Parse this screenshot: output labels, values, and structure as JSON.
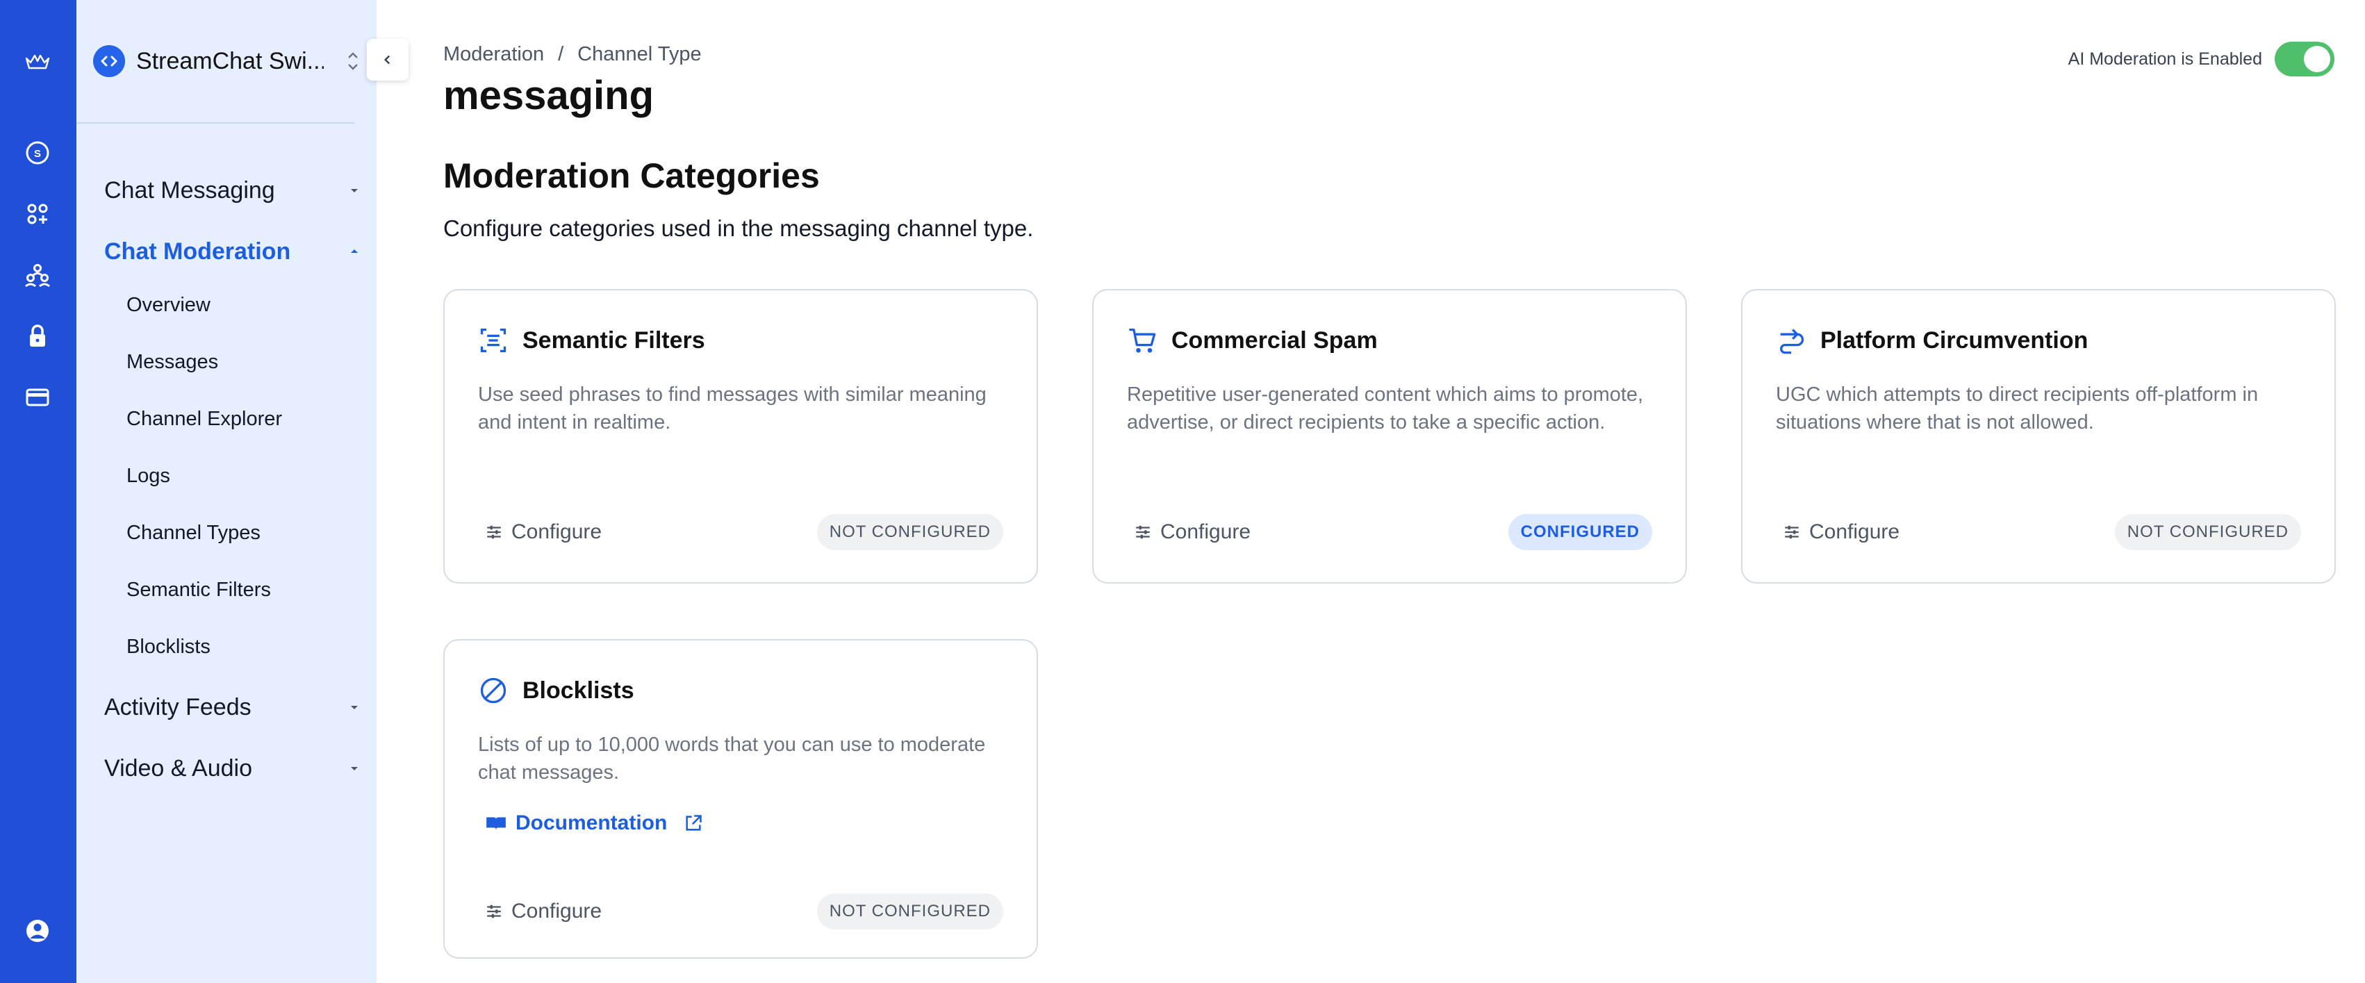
{
  "rail": {
    "icons": [
      "boat-logo-icon",
      "dollar-icon",
      "apps-icon",
      "team-icon",
      "lock-icon",
      "billing-card-icon",
      "account-icon"
    ]
  },
  "project": {
    "name": "StreamChat Swi..."
  },
  "sidebar": {
    "sections": [
      {
        "label": "Chat Messaging",
        "expanded": false
      },
      {
        "label": "Chat Moderation",
        "expanded": true
      },
      {
        "label": "Activity Feeds",
        "expanded": false
      },
      {
        "label": "Video & Audio",
        "expanded": false
      }
    ],
    "moderation_items": [
      "Overview",
      "Messages",
      "Channel Explorer",
      "Logs",
      "Channel Types",
      "Semantic Filters",
      "Blocklists"
    ]
  },
  "breadcrumb": {
    "parent": "Moderation",
    "separator": "/",
    "current": "Channel Type"
  },
  "page": {
    "title": "messaging",
    "section_title": "Moderation Categories",
    "section_desc": "Configure categories used in the messaging channel type."
  },
  "ai_toggle": {
    "label": "AI Moderation is Enabled",
    "enabled": true
  },
  "cards": [
    {
      "title": "Semantic Filters",
      "icon": "filter-lines-icon",
      "text": "Use seed phrases to find messages with similar meaning and intent in realtime.",
      "configure_label": "Configure",
      "status": "NOT CONFIGURED"
    },
    {
      "title": "Commercial Spam",
      "icon": "shopping-cart-icon",
      "text": "Repetitive user-generated content which aims to promote, advertise, or direct recipients to take a specific action.",
      "configure_label": "Configure",
      "status": "CONFIGURED"
    },
    {
      "title": "Platform Circumvention",
      "icon": "redirect-route-icon",
      "text": "UGC which attempts to direct recipients off-platform in situations where that is not allowed.",
      "configure_label": "Configure",
      "status": "NOT CONFIGURED"
    },
    {
      "title": "Blocklists",
      "icon": "block-icon",
      "text": "Lists of up to 10,000 words that you can use to moderate chat messages.",
      "link_label": "Documentation",
      "configure_label": "Configure",
      "status": "NOT CONFIGURED"
    }
  ],
  "colors": {
    "rail": "#2150d8",
    "sidebar": "#e6efff",
    "accent": "#1d5ee0",
    "toggle_on": "#4fbf6b"
  }
}
